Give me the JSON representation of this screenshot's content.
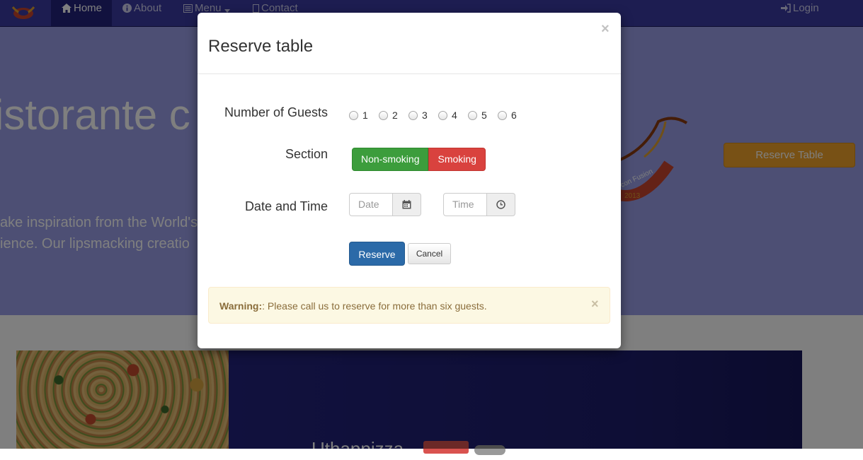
{
  "navbar": {
    "items": [
      {
        "label": "Home",
        "icon": "home-icon"
      },
      {
        "label": "About",
        "icon": "info-icon"
      },
      {
        "label": "Menu",
        "icon": "list-icon"
      },
      {
        "label": "Contact",
        "icon": "envelope-icon"
      }
    ],
    "login_label": "Login"
  },
  "jumbotron": {
    "title": "istorante c",
    "text_line1": "ake inspiration from the World's",
    "text_line2": "ience. Our lipsmacking creatio",
    "reserve_button": "Reserve Table",
    "logo_text": "con Fusion",
    "logo_year": "2013"
  },
  "media": {
    "heading": "Uthappizza"
  },
  "modal": {
    "title": "Reserve table",
    "close_symbol": "×",
    "guests_label": "Number of Guests",
    "guest_options": [
      "1",
      "2",
      "3",
      "4",
      "5",
      "6"
    ],
    "section_label": "Section",
    "section_options": [
      "Non-smoking",
      "Smoking"
    ],
    "datetime_label": "Date and Time",
    "date_placeholder": "Date",
    "time_placeholder": "Time",
    "reserve_button": "Reserve",
    "cancel_button": "Cancel",
    "alert": {
      "strong": "Warning:",
      "message": ": Please call us to reserve for more than six guests.",
      "close_symbol": "×"
    }
  },
  "colors": {
    "navbar": "#3a3aa3",
    "jumbotron": "#9a9fe8",
    "success": "#3c9d3c",
    "danger": "#d9423e",
    "primary": "#2b6aa8",
    "warning_bg": "#fcf8e3"
  }
}
